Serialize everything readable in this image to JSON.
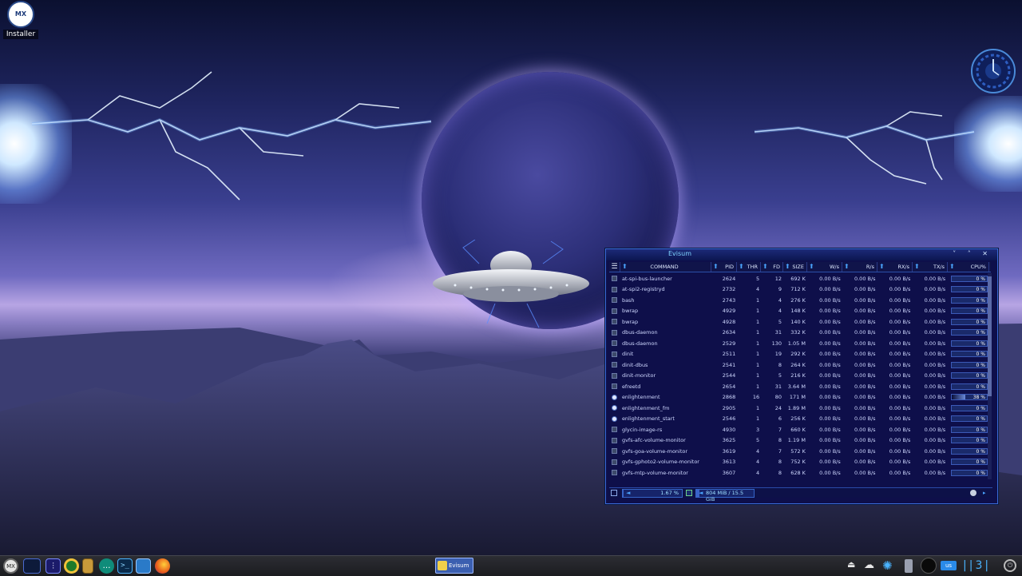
{
  "desktop": {
    "installer_label": "Installer",
    "installer_logo_text": "MX"
  },
  "window": {
    "title": "Evisum",
    "controls": [
      "˅",
      "˄",
      "✕"
    ],
    "columns": [
      "COMMAND",
      "PID",
      "THR",
      "FD",
      "SIZE",
      "W/s",
      "R/s",
      "RX/s",
      "TX/s",
      "CPU%"
    ],
    "rows": [
      {
        "cmd": "at-spi-bus-launcher",
        "pid": "2624",
        "thr": "5",
        "fd": "12",
        "size": "692 K",
        "ws": "0.00 B/s",
        "rs": "0.00 B/s",
        "rx": "0.00 B/s",
        "tx": "0.00 B/s",
        "cpu": "0 %",
        "cpu_val": 0,
        "icon": "generic"
      },
      {
        "cmd": "at-spi2-registryd",
        "pid": "2732",
        "thr": "4",
        "fd": "9",
        "size": "712 K",
        "ws": "0.00 B/s",
        "rs": "0.00 B/s",
        "rx": "0.00 B/s",
        "tx": "0.00 B/s",
        "cpu": "0 %",
        "cpu_val": 0,
        "icon": "generic"
      },
      {
        "cmd": "bash",
        "pid": "2743",
        "thr": "1",
        "fd": "4",
        "size": "276 K",
        "ws": "0.00 B/s",
        "rs": "0.00 B/s",
        "rx": "0.00 B/s",
        "tx": "0.00 B/s",
        "cpu": "0 %",
        "cpu_val": 0,
        "icon": "generic"
      },
      {
        "cmd": "bwrap",
        "pid": "4929",
        "thr": "1",
        "fd": "4",
        "size": "148 K",
        "ws": "0.00 B/s",
        "rs": "0.00 B/s",
        "rx": "0.00 B/s",
        "tx": "0.00 B/s",
        "cpu": "0 %",
        "cpu_val": 0,
        "icon": "generic"
      },
      {
        "cmd": "bwrap",
        "pid": "4928",
        "thr": "1",
        "fd": "5",
        "size": "140 K",
        "ws": "0.00 B/s",
        "rs": "0.00 B/s",
        "rx": "0.00 B/s",
        "tx": "0.00 B/s",
        "cpu": "0 %",
        "cpu_val": 0,
        "icon": "generic"
      },
      {
        "cmd": "dbus-daemon",
        "pid": "2634",
        "thr": "1",
        "fd": "31",
        "size": "332 K",
        "ws": "0.00 B/s",
        "rs": "0.00 B/s",
        "rx": "0.00 B/s",
        "tx": "0.00 B/s",
        "cpu": "0 %",
        "cpu_val": 0,
        "icon": "generic"
      },
      {
        "cmd": "dbus-daemon",
        "pid": "2529",
        "thr": "1",
        "fd": "130",
        "size": "1.05 M",
        "ws": "0.00 B/s",
        "rs": "0.00 B/s",
        "rx": "0.00 B/s",
        "tx": "0.00 B/s",
        "cpu": "0 %",
        "cpu_val": 0,
        "icon": "generic"
      },
      {
        "cmd": "dinit",
        "pid": "2511",
        "thr": "1",
        "fd": "19",
        "size": "292 K",
        "ws": "0.00 B/s",
        "rs": "0.00 B/s",
        "rx": "0.00 B/s",
        "tx": "0.00 B/s",
        "cpu": "0 %",
        "cpu_val": 0,
        "icon": "generic"
      },
      {
        "cmd": "dinit-dbus",
        "pid": "2541",
        "thr": "1",
        "fd": "8",
        "size": "264 K",
        "ws": "0.00 B/s",
        "rs": "0.00 B/s",
        "rx": "0.00 B/s",
        "tx": "0.00 B/s",
        "cpu": "0 %",
        "cpu_val": 0,
        "icon": "generic"
      },
      {
        "cmd": "dinit-monitor",
        "pid": "2544",
        "thr": "1",
        "fd": "5",
        "size": "216 K",
        "ws": "0.00 B/s",
        "rs": "0.00 B/s",
        "rx": "0.00 B/s",
        "tx": "0.00 B/s",
        "cpu": "0 %",
        "cpu_val": 0,
        "icon": "generic"
      },
      {
        "cmd": "efreetd",
        "pid": "2654",
        "thr": "1",
        "fd": "31",
        "size": "3.64 M",
        "ws": "0.00 B/s",
        "rs": "0.00 B/s",
        "rx": "0.00 B/s",
        "tx": "0.00 B/s",
        "cpu": "0 %",
        "cpu_val": 0,
        "icon": "generic"
      },
      {
        "cmd": "enlightenment",
        "pid": "2868",
        "thr": "16",
        "fd": "80",
        "size": "171 M",
        "ws": "0.00 B/s",
        "rs": "0.00 B/s",
        "rx": "0.00 B/s",
        "tx": "0.00 B/s",
        "cpu": "38 %",
        "cpu_val": 38,
        "icon": "e"
      },
      {
        "cmd": "enlightenment_fm",
        "pid": "2905",
        "thr": "1",
        "fd": "24",
        "size": "1.89 M",
        "ws": "0.00 B/s",
        "rs": "0.00 B/s",
        "rx": "0.00 B/s",
        "tx": "0.00 B/s",
        "cpu": "0 %",
        "cpu_val": 0,
        "icon": "e"
      },
      {
        "cmd": "enlightenment_start",
        "pid": "2546",
        "thr": "1",
        "fd": "6",
        "size": "256 K",
        "ws": "0.00 B/s",
        "rs": "0.00 B/s",
        "rx": "0.00 B/s",
        "tx": "0.00 B/s",
        "cpu": "0 %",
        "cpu_val": 0,
        "icon": "e"
      },
      {
        "cmd": "glycin-image-rs",
        "pid": "4930",
        "thr": "3",
        "fd": "7",
        "size": "660 K",
        "ws": "0.00 B/s",
        "rs": "0.00 B/s",
        "rx": "0.00 B/s",
        "tx": "0.00 B/s",
        "cpu": "0 %",
        "cpu_val": 0,
        "icon": "generic"
      },
      {
        "cmd": "gvfs-afc-volume-monitor",
        "pid": "3625",
        "thr": "5",
        "fd": "8",
        "size": "1.19 M",
        "ws": "0.00 B/s",
        "rs": "0.00 B/s",
        "rx": "0.00 B/s",
        "tx": "0.00 B/s",
        "cpu": "0 %",
        "cpu_val": 0,
        "icon": "generic"
      },
      {
        "cmd": "gvfs-goa-volume-monitor",
        "pid": "3619",
        "thr": "4",
        "fd": "7",
        "size": "572 K",
        "ws": "0.00 B/s",
        "rs": "0.00 B/s",
        "rx": "0.00 B/s",
        "tx": "0.00 B/s",
        "cpu": "0 %",
        "cpu_val": 0,
        "icon": "generic"
      },
      {
        "cmd": "gvfs-gphoto2-volume-monitor",
        "pid": "3613",
        "thr": "4",
        "fd": "8",
        "size": "752 K",
        "ws": "0.00 B/s",
        "rs": "0.00 B/s",
        "rx": "0.00 B/s",
        "tx": "0.00 B/s",
        "cpu": "0 %",
        "cpu_val": 0,
        "icon": "generic"
      },
      {
        "cmd": "gvfs-mtp-volume-monitor",
        "pid": "3607",
        "thr": "4",
        "fd": "8",
        "size": "628 K",
        "ws": "0.00 B/s",
        "rs": "0.00 B/s",
        "rx": "0.00 B/s",
        "tx": "0.00 B/s",
        "cpu": "0 %",
        "cpu_val": 0,
        "icon": "generic"
      }
    ],
    "footer": {
      "cpu_text": "1.67 %",
      "cpu_fraction": 0.0167,
      "mem_text": "804 MiB / 15.5 GiB",
      "mem_fraction": 0.05
    }
  },
  "taskbar": {
    "start_label": "MX",
    "task_label": "Evisum",
    "kbd_layout": "us",
    "pager_text": "3",
    "launchers": [
      "desktop-preview-icon",
      "mixer-icon",
      "settings-icon",
      "archive-icon",
      "chat-icon",
      "terminal-icon",
      "file-manager-icon",
      "firefox-icon"
    ],
    "tray": [
      "eject-icon",
      "cloud-icon",
      "flower-icon",
      "usb-icon",
      "circle-icon",
      "keyboard-icon",
      "pager-icon",
      "power-icon"
    ]
  },
  "colors": {
    "accent": "#3a6ad8",
    "window_bg": "#0e0f4a",
    "title_text": "#7fd4ff",
    "arrow": "#4aa4ff"
  }
}
